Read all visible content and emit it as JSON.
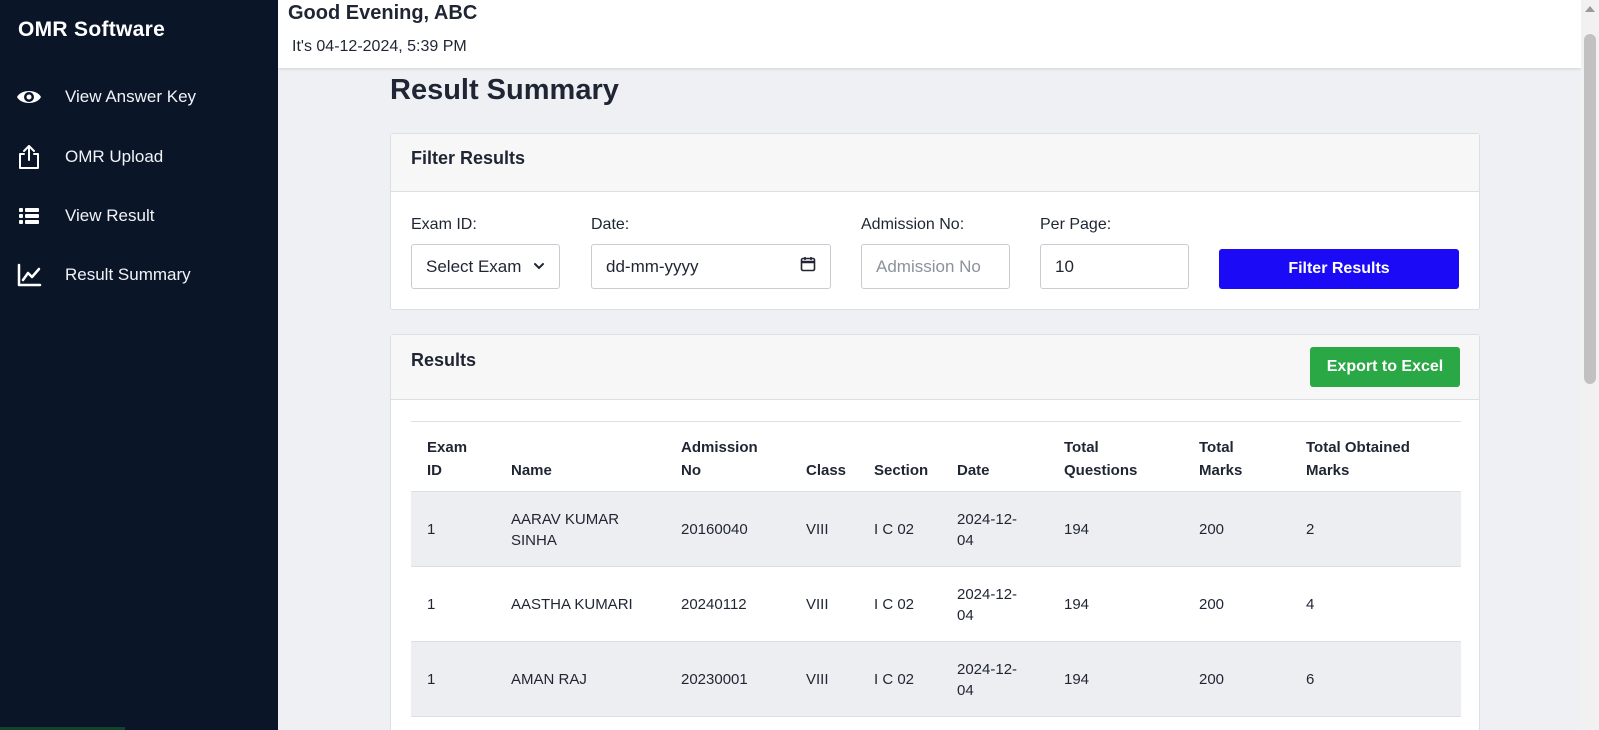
{
  "app": {
    "brand": "OMR Software"
  },
  "sidebar": {
    "items": [
      {
        "label": "View Answer Key",
        "icon": "eye-icon"
      },
      {
        "label": "OMR Upload",
        "icon": "upload-icon"
      },
      {
        "label": "View Result",
        "icon": "list-icon"
      },
      {
        "label": "Result Summary",
        "icon": "chart-line-icon"
      }
    ]
  },
  "header": {
    "greeting": "Good Evening, ABC",
    "datetime": "It's 04-12-2024, 5:39 PM"
  },
  "page": {
    "title": "Result Summary"
  },
  "filter": {
    "title": "Filter Results",
    "exam_id_label": "Exam ID:",
    "exam_id_value": "Select Exam",
    "date_label": "Date:",
    "date_placeholder": "dd-mm-yyyy",
    "admission_label": "Admission No:",
    "admission_placeholder": "Admission No",
    "per_page_label": "Per Page:",
    "per_page_value": "10",
    "button_label": "Filter Results"
  },
  "results": {
    "title": "Results",
    "export_label": "Export to Excel",
    "headers": {
      "exam_id": [
        "Exam",
        "ID"
      ],
      "name": "Name",
      "admission_no": [
        "Admission",
        "No"
      ],
      "class": "Class",
      "section": "Section",
      "date": "Date",
      "total_questions": [
        "Total",
        "Questions"
      ],
      "total_marks": [
        "Total",
        "Marks"
      ],
      "total_obtained": [
        "Total Obtained",
        "Marks"
      ]
    },
    "rows": [
      {
        "exam_id": "1",
        "name": [
          "AARAV KUMAR",
          "SINHA"
        ],
        "admission_no": "20160040",
        "class": "VIII",
        "section": "I C 02",
        "date": [
          "2024-12-",
          "04"
        ],
        "total_questions": "194",
        "total_marks": "200",
        "total_obtained": "2"
      },
      {
        "exam_id": "1",
        "name": [
          "AASTHA KUMARI"
        ],
        "admission_no": "20240112",
        "class": "VIII",
        "section": "I C 02",
        "date": [
          "2024-12-",
          "04"
        ],
        "total_questions": "194",
        "total_marks": "200",
        "total_obtained": "4"
      },
      {
        "exam_id": "1",
        "name": [
          "AMAN RAJ"
        ],
        "admission_no": "20230001",
        "class": "VIII",
        "section": "I C 02",
        "date": [
          "2024-12-",
          "04"
        ],
        "total_questions": "194",
        "total_marks": "200",
        "total_obtained": "6"
      }
    ]
  },
  "colors": {
    "sidebar_bg": "#0b1528",
    "filter_button": "#1b0af5",
    "export_button": "#2aa845",
    "row_stripe": "#eceef1"
  }
}
